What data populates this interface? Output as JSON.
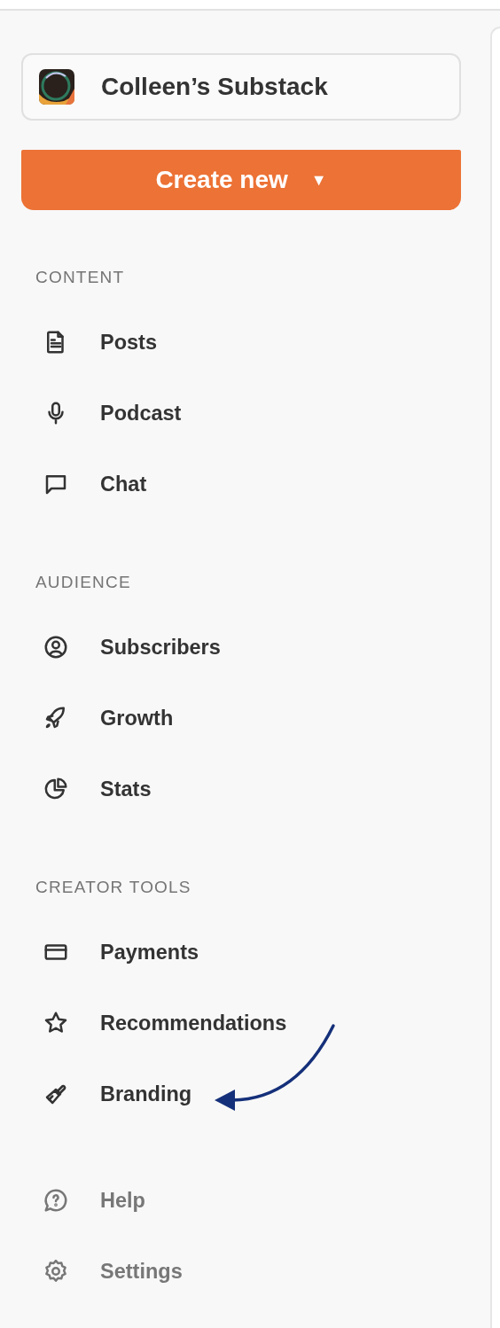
{
  "publication": {
    "name": "Colleen’s Substack"
  },
  "create_button": {
    "label": "Create new",
    "caret": "▼"
  },
  "sections": [
    {
      "title": "CONTENT",
      "items": [
        {
          "label": "Posts"
        },
        {
          "label": "Podcast"
        },
        {
          "label": "Chat"
        }
      ]
    },
    {
      "title": "AUDIENCE",
      "items": [
        {
          "label": "Subscribers"
        },
        {
          "label": "Growth"
        },
        {
          "label": "Stats"
        }
      ]
    },
    {
      "title": "CREATOR TOOLS",
      "items": [
        {
          "label": "Payments"
        },
        {
          "label": "Recommendations"
        },
        {
          "label": "Branding"
        }
      ]
    }
  ],
  "footer_items": [
    {
      "label": "Help"
    },
    {
      "label": "Settings"
    }
  ]
}
